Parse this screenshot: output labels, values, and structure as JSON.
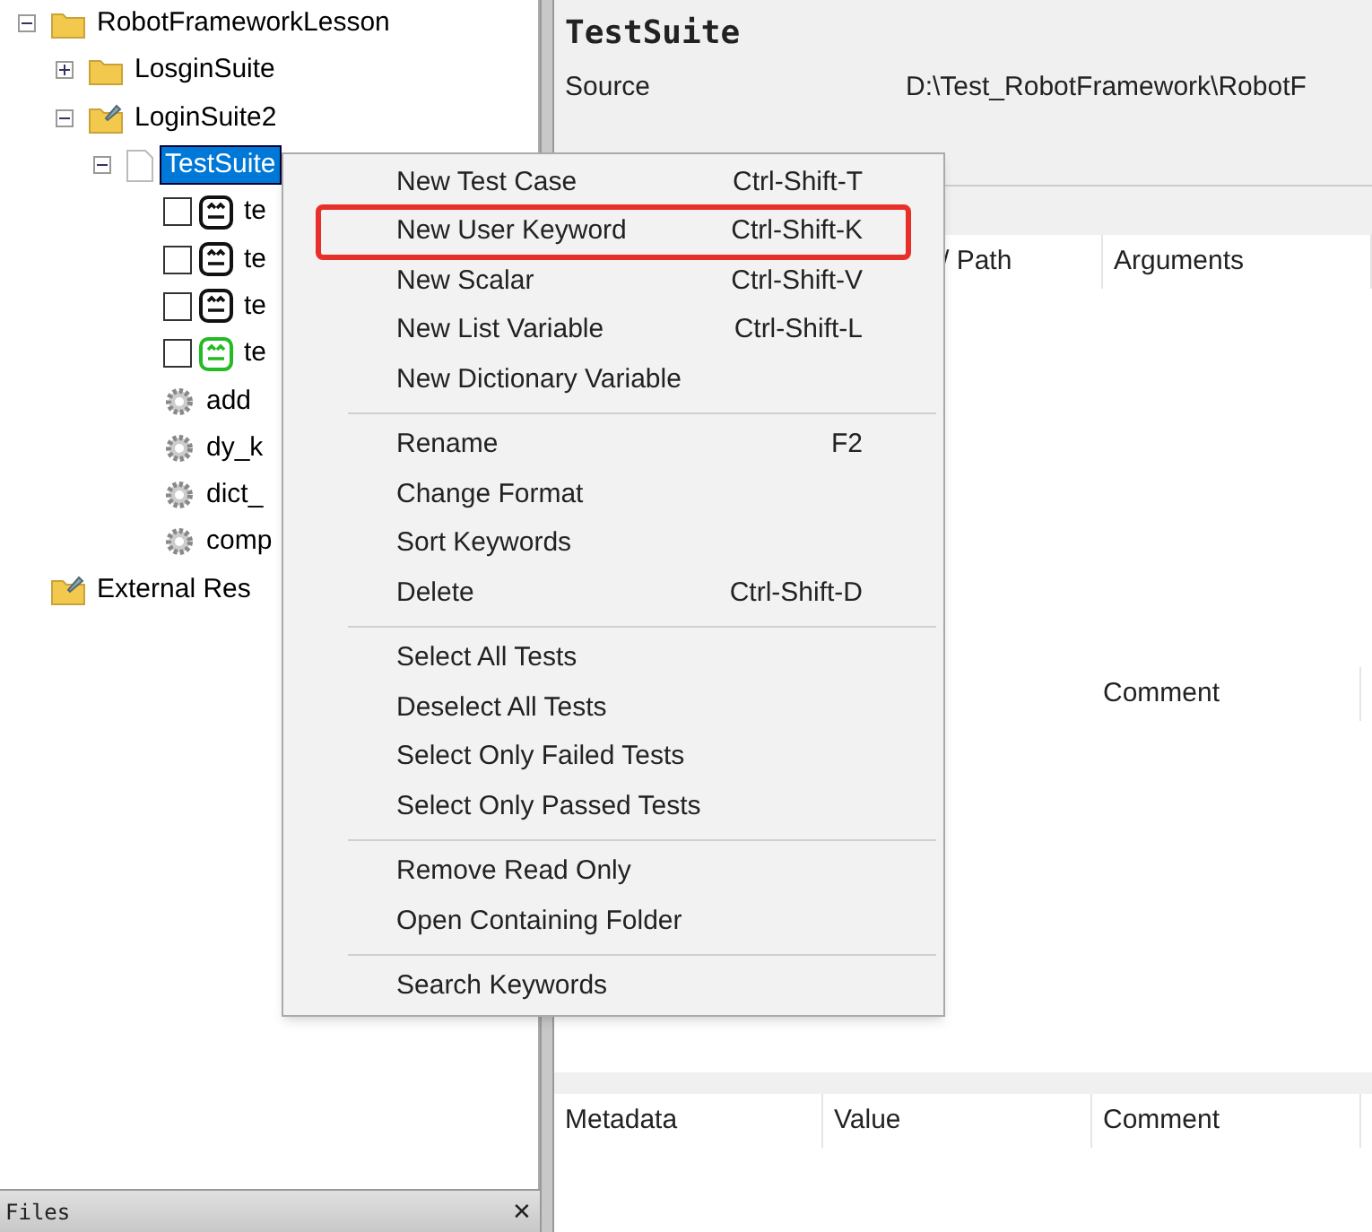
{
  "tree": [
    {
      "label": "RobotFrameworkLesson",
      "kind": "folder",
      "expanded": true,
      "selected": false,
      "children": [
        {
          "label": "LosginSuite",
          "kind": "folder",
          "expanded": false,
          "selected": false
        },
        {
          "label": "LoginSuite2",
          "kind": "suite_folder",
          "expanded": true,
          "selected": false,
          "children": [
            {
              "label": "TestSuite",
              "kind": "file",
              "expanded": true,
              "selected": true,
              "children": [
                {
                  "label": "te",
                  "kind": "test",
                  "checked": false,
                  "passed": false,
                  "selected": false
                },
                {
                  "label": "te",
                  "kind": "test",
                  "checked": false,
                  "passed": false,
                  "selected": false
                },
                {
                  "label": "te",
                  "kind": "test",
                  "checked": false,
                  "passed": false,
                  "selected": false
                },
                {
                  "label": "te",
                  "kind": "test",
                  "checked": false,
                  "passed": true,
                  "selected": false
                },
                {
                  "label": "add",
                  "kind": "keyword",
                  "selected": false
                },
                {
                  "label": "dy_k",
                  "kind": "keyword",
                  "selected": false
                },
                {
                  "label": "dict_",
                  "kind": "keyword",
                  "selected": false
                },
                {
                  "label": "comp",
                  "kind": "keyword",
                  "selected": false
                }
              ]
            }
          ]
        }
      ]
    },
    {
      "label": "External Res",
      "kind": "resource",
      "selected": false
    }
  ],
  "files_panel": {
    "title": "Files",
    "close": "✕"
  },
  "editor": {
    "title": "TestSuite",
    "source_label": "Source",
    "source_value": "D:\\Test_RobotFramework\\RobotF",
    "settings_columns": [
      "/ Path",
      "Arguments"
    ],
    "variables_columns": [
      "Comment"
    ],
    "metadata_columns": [
      "Metadata",
      "Value",
      "Comment"
    ]
  },
  "context_menu": {
    "groups": [
      [
        {
          "label": "New Test Case",
          "shortcut": "Ctrl-Shift-T",
          "highlighted": false
        },
        {
          "label": "New User Keyword",
          "shortcut": "Ctrl-Shift-K",
          "highlighted": true
        },
        {
          "label": "New Scalar",
          "shortcut": "Ctrl-Shift-V",
          "highlighted": false
        },
        {
          "label": "New List Variable",
          "shortcut": "Ctrl-Shift-L",
          "highlighted": false
        },
        {
          "label": "New Dictionary Variable",
          "highlighted": false
        }
      ],
      [
        {
          "label": "Rename",
          "shortcut": "F2",
          "highlighted": false
        },
        {
          "label": "Change Format",
          "highlighted": false
        },
        {
          "label": "Sort Keywords",
          "highlighted": false
        },
        {
          "label": "Delete",
          "shortcut": "Ctrl-Shift-D",
          "highlighted": false
        }
      ],
      [
        {
          "label": "Select All Tests",
          "highlighted": false
        },
        {
          "label": "Deselect All Tests",
          "highlighted": false
        },
        {
          "label": "Select Only Failed Tests",
          "highlighted": false
        },
        {
          "label": "Select Only Passed Tests",
          "highlighted": false
        }
      ],
      [
        {
          "label": "Remove Read Only",
          "highlighted": false
        },
        {
          "label": "Open Containing Folder",
          "highlighted": false
        }
      ],
      [
        {
          "label": "Search Keywords",
          "highlighted": false
        }
      ]
    ]
  }
}
